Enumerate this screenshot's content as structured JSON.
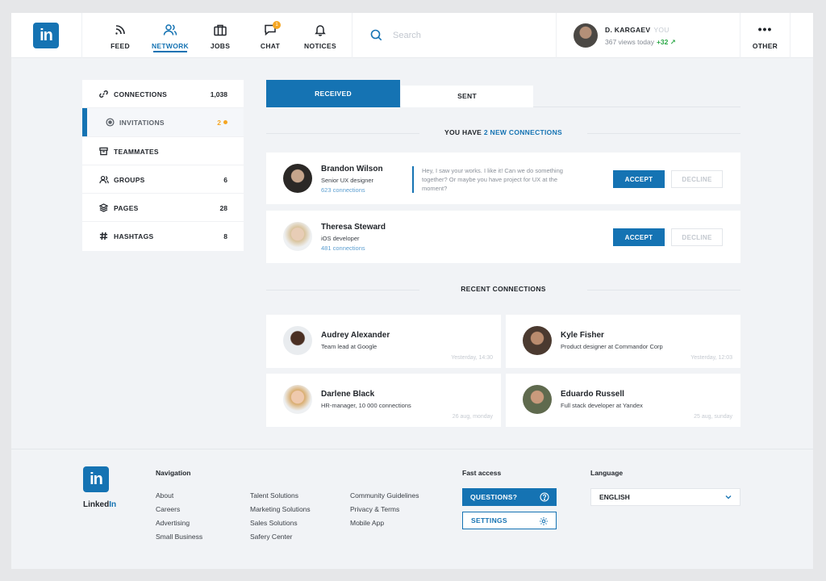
{
  "header": {
    "logo": "in",
    "nav": [
      {
        "label": "FEED",
        "icon": "rss-icon"
      },
      {
        "label": "NETWORK",
        "icon": "users-icon"
      },
      {
        "label": "JOBS",
        "icon": "briefcase-icon"
      },
      {
        "label": "CHAT",
        "icon": "chat-icon",
        "badge": "1"
      },
      {
        "label": "NOTICES",
        "icon": "bell-icon"
      }
    ],
    "search_placeholder": "Search",
    "user": {
      "name": "D. KARGAEV",
      "you": "YOU",
      "views": "367 views today",
      "views_delta": "+32 ↗"
    },
    "other_label": "OTHER"
  },
  "sidebar": {
    "items": [
      {
        "label": "CONNECTIONS",
        "count": "1,038",
        "icon": "link-icon"
      },
      {
        "label": "INVITATIONS",
        "count": "2",
        "icon": "target-icon"
      },
      {
        "label": "TEAMMATES",
        "count": "",
        "icon": "archive-icon"
      },
      {
        "label": "GROUPS",
        "count": "6",
        "icon": "group-icon"
      },
      {
        "label": "PAGES",
        "count": "28",
        "icon": "layers-icon"
      },
      {
        "label": "HASHTAGS",
        "count": "8",
        "icon": "hashtag-icon"
      }
    ]
  },
  "tabs": {
    "received": "RECEIVED",
    "sent": "SENT"
  },
  "invitations": {
    "title_prefix": "YOU HAVE",
    "title_highlight": "2 NEW CONNECTIONS",
    "items": [
      {
        "name": "Brandon Wilson",
        "role": "Senior UX designer",
        "connections": "623 connections",
        "message": "Hey, I saw your works. I like it! Can we do something together? Or maybe you have project for UX at the moment?"
      },
      {
        "name": "Theresa Steward",
        "role": "iOS developer",
        "connections": "481 connections",
        "message": ""
      }
    ],
    "accept_label": "ACCEPT",
    "decline_label": "DECLINE"
  },
  "recent": {
    "title": "RECENT CONNECTIONS",
    "items": [
      {
        "name": "Audrey Alexander",
        "role": "Team lead at Google",
        "time": "Yesterday, 14:30"
      },
      {
        "name": "Kyle Fisher",
        "role": "Product designer at Commandor Corp",
        "time": "Yesterday, 12:03"
      },
      {
        "name": "Darlene Black",
        "role": "HR-manager, 10 000 connections",
        "time": "26 aug, monday"
      },
      {
        "name": "Eduardo Russell",
        "role": "Full stack developer at Yandex",
        "time": "25 aug, sunday"
      }
    ]
  },
  "footer": {
    "brand_prefix": "Linked",
    "brand_suffix": "In",
    "navigation_title": "Navigation",
    "nav_col1": [
      "About",
      "Careers",
      "Advertising",
      "Small Business"
    ],
    "nav_col2": [
      "Talent Solutions",
      "Marketing Solutions",
      "Sales Solutions",
      "Safery Center"
    ],
    "nav_col3": [
      "Community Guidelines",
      "Privacy & Terms",
      "Mobile App"
    ],
    "fast_access_title": "Fast access",
    "questions_label": "QUESTIONS?",
    "settings_label": "SETTINGS",
    "language_title": "Language",
    "language_value": "ENGLISH"
  },
  "colors": {
    "accent": "#1573b3",
    "badge": "#f5a623",
    "positive": "#29a745"
  }
}
